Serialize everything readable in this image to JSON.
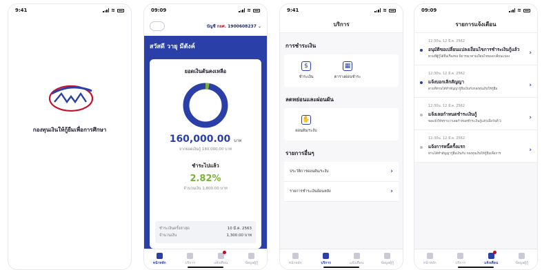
{
  "colors": {
    "brand": "#2a3fa7",
    "accent_red": "#c8102e",
    "progress_green": "#7ab33a"
  },
  "screen1": {
    "time": "9:41",
    "tagline": "กองทุนเงินให้กู้ยืมเพื่อการศึกษา"
  },
  "screen2": {
    "time": "09:09",
    "account_prefix": "บัญชี",
    "account_org": "กยศ.",
    "account_number": "1900608237",
    "greeting": "สวัสดี วายุ มีตังค์",
    "balance_title": "ยอดเงินต้นคงเหลือ",
    "balance_value": "160,000.00",
    "balance_unit": "บาท",
    "balance_sub": "จากยอดเงินกู้ 180,000.00 บาท",
    "paid_fraction": 0.028,
    "paid_title": "ชำระไปแล้ว",
    "paid_percent": "2.82%",
    "paid_sub": "จำนวนเงิน 1,800.00 บาท",
    "last_label": "ชำระเงินครั้งล่าสุด",
    "last_date": "10 มี.ค. 2563",
    "amount_label": "จำนวนเงิน",
    "amount_value": "1,300.00 บาท"
  },
  "screen3": {
    "time": "9:41",
    "title": "บริการ",
    "section_payment": "การชำระเงิน",
    "svc_pay": "ชำระเงิน",
    "svc_schedule": "ตารางผ่อนชำระ",
    "section_relief": "ลดหย่อนและผ่อนผัน",
    "svc_defer": "ผ่อนผัน/ระงับ",
    "section_other": "รายการอื่นๆ",
    "item_history": "ประวัติการผ่อนผัน/ระงับ",
    "item_refund": "รายการชำระเงินย้อนหลัง"
  },
  "screen4": {
    "time": "09:09",
    "title": "รายการแจ้งเตือน",
    "notifications": [
      {
        "time": "12:30น. 12 มี.ค. 2562",
        "title": "อนุมัติขอเปลี่ยนแปลงเงื่อนไขการชำระเงินกู้แล้ว",
        "body": "ตามที่ผู้กู้ได้ยื่นเรื่องขอ พิจารณาตามเงื่อนไขของเปลี่ยนแปลง"
      },
      {
        "time": "12:30น. 12 มี.ค. 2562",
        "title": "แจ้งบอกเลิกสัญญา",
        "body": "ตามที่ท่านได้ทำสัญญากู้ยืมเงินกับกองทุนเงินให้กู้ยืม"
      },
      {
        "time": "12:30น. 12 มี.ค. 2562",
        "title": "แจ้งเลยกำหนดชำระเงินกู้",
        "body": "ขอแจ้งให้ทราบว่าเลยกำหนดชำระเงินกู้แล้วเมื่อวันที่ 5"
      },
      {
        "time": "12:30น. 12 มี.ค. 2562",
        "title": "แจ้งการหนี้ครั้งแรก",
        "body": "ท่านได้ทำสัญญากู้ยืมเงินกับ กองทุนเงินให้กู้ยืมเพื่อการ"
      }
    ]
  },
  "tabs": {
    "home": "หน้าหลัก",
    "services": "บริการ",
    "notify": "แจ้งเตือน",
    "profile": "ข้อมูลผู้กู้"
  }
}
